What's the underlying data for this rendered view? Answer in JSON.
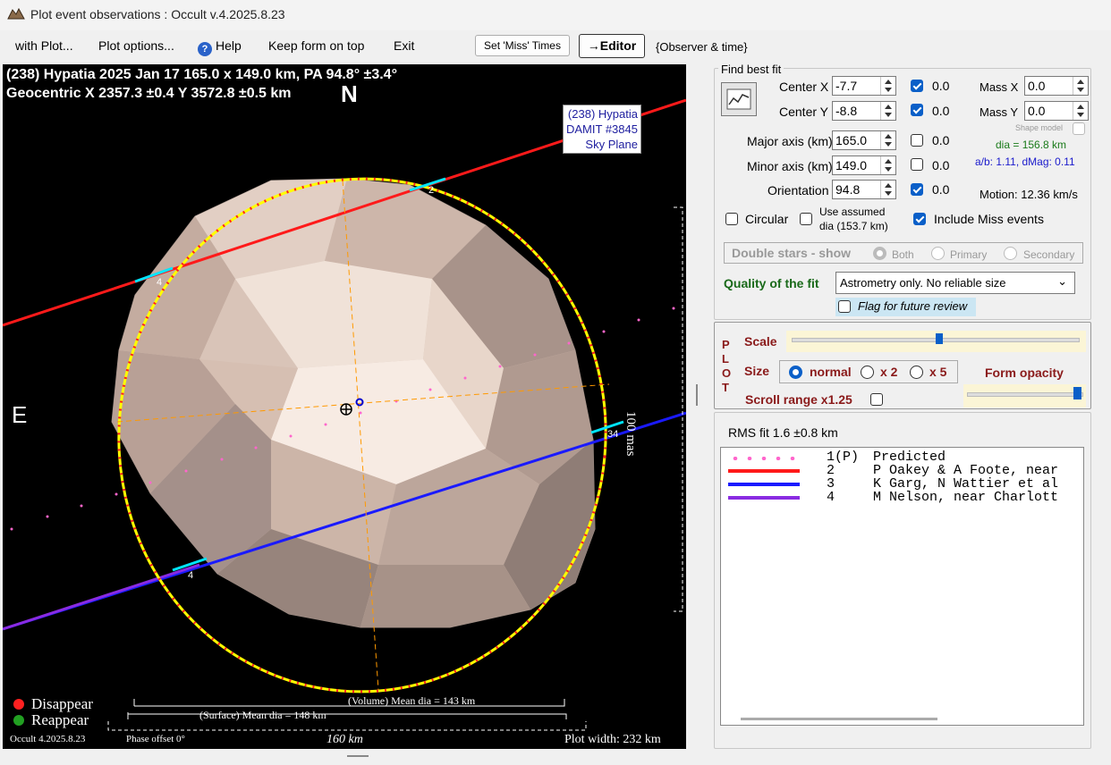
{
  "window": {
    "title": "Plot event observations : Occult v.4.2025.8.23"
  },
  "menu": {
    "with_plot": "with Plot...",
    "plot_options": "Plot options...",
    "help": "Help",
    "keep_on_top": "Keep form on top",
    "exit": "Exit",
    "set_miss_times": "Set 'Miss' Times",
    "editor": "→Editor",
    "observer_time": "{Observer & time}"
  },
  "plot": {
    "title_line1": "(238) Hypatia  2025 Jan 17   165.0 x 149.0 km, PA 94.8° ±3.4°",
    "title_line2": "Geocentric  X  2357.3 ±0.4  Y 3572.8 ±0.5 km",
    "north": "N",
    "east": "E",
    "model_label_1": "(238) Hypatia",
    "model_label_2": "DAMIT #3845",
    "model_label_3": "Sky Plane",
    "scale_mas": "100 mas",
    "legend_disappear": "Disappear",
    "legend_reappear": "Reappear",
    "volume_dia": "(Volume) Mean dia = 143 km",
    "surface_dia": "(Surface) Mean dia = 148 km",
    "version": "Occult 4.2025.8.23",
    "phase_offset": "Phase offset 0°",
    "scale_km": "160 km",
    "plot_width": "Plot width: 232 km",
    "chord_labels": [
      "2",
      "4",
      "34",
      "4",
      "1"
    ],
    "colors": {
      "disappear": "#ff2020",
      "reappear": "#22a022",
      "fit_ellipse": "#ffff00",
      "chord2": "#ff1a1a",
      "chord3": "#2020ff",
      "chord4": "#8a2be2"
    }
  },
  "fit": {
    "group_label": "Find best fit",
    "center_x_label": "Center X",
    "center_x": "-7.7",
    "center_x_unc": "0.0",
    "center_y_label": "Center Y",
    "center_y": "-8.8",
    "center_y_unc": "0.0",
    "major_label": "Major axis (km)",
    "major": "165.0",
    "major_unc": "0.0",
    "minor_label": "Minor axis (km)",
    "minor": "149.0",
    "minor_unc": "0.0",
    "orient_label": "Orientation",
    "orient": "94.8",
    "orient_unc": "0.0",
    "mass_x_label": "Mass X",
    "mass_x": "0.0",
    "mass_y_label": "Mass Y",
    "mass_y": "0.0",
    "shape_model": "Shape model",
    "dia": "dia = 156.8 km",
    "ab": "a/b: 1.11, dMag: 0.11",
    "motion": "Motion: 12.36 km/s",
    "circular": "Circular",
    "use_assumed_1": "Use assumed",
    "use_assumed_2": "dia (153.7 km)",
    "include_miss": "Include Miss events",
    "double_stars": "Double stars - show",
    "both": "Both",
    "primary": "Primary",
    "secondary": "Secondary",
    "quality_label": "Quality of the fit",
    "quality_value": "Astrometry only. No reliable size",
    "flag_review": "Flag for future review"
  },
  "plotctl": {
    "vertical": [
      "P",
      "L",
      "O",
      "T"
    ],
    "scale": "Scale",
    "size": "Size",
    "normal": "normal",
    "x2": "x 2",
    "x5": "x 5",
    "form_opacity": "Form opacity",
    "scroll_range": "Scroll range x1.25"
  },
  "rms": {
    "label": "RMS fit 1.6 ±0.8 km",
    "rows": [
      {
        "num": "1(P)",
        "name": "Predicted",
        "color": "#ff66cc"
      },
      {
        "num": "2",
        "name": "P Oakey & A Foote, near",
        "color": "#ff1a1a"
      },
      {
        "num": "3",
        "name": "K Garg, N Wattier et al",
        "color": "#1a1aff"
      },
      {
        "num": "4",
        "name": "M Nelson, near Charlott",
        "color": "#8a2be2"
      }
    ]
  }
}
